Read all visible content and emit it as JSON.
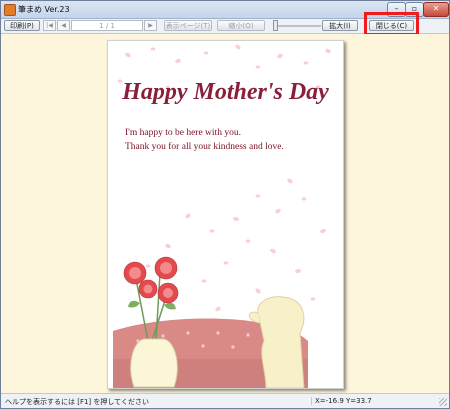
{
  "window": {
    "title": "筆まめ Ver.23",
    "min_glyph": "–",
    "max_glyph": "▫",
    "close_glyph": "✕"
  },
  "toolbar": {
    "print_label": "印刷(P)",
    "first_glyph": "|◀",
    "prev_glyph": "◀",
    "page_value": "1 / 1",
    "next_glyph": "▶",
    "show_page_label": "表示ページ(T)",
    "zoom_out_label": "縮小(O)",
    "zoom_in_label": "拡大(I)",
    "close_label": "閉じる(C)"
  },
  "card": {
    "title": "Happy Mother's Day",
    "message_lines": [
      "I'm happy to be here with you.",
      "Thank you for all your kindness and love."
    ]
  },
  "status": {
    "help_text": "ヘルプを表示するには [F1] を押してください",
    "coords_text": "X=-16.9 Y=33.7"
  },
  "colors": {
    "title": "#8a1f3a",
    "message": "#7a1024",
    "highlight": "#ee1c1c",
    "petals": "#f6c8cf",
    "flower": "#e24a4e",
    "tablecloth": "#d98a86"
  }
}
